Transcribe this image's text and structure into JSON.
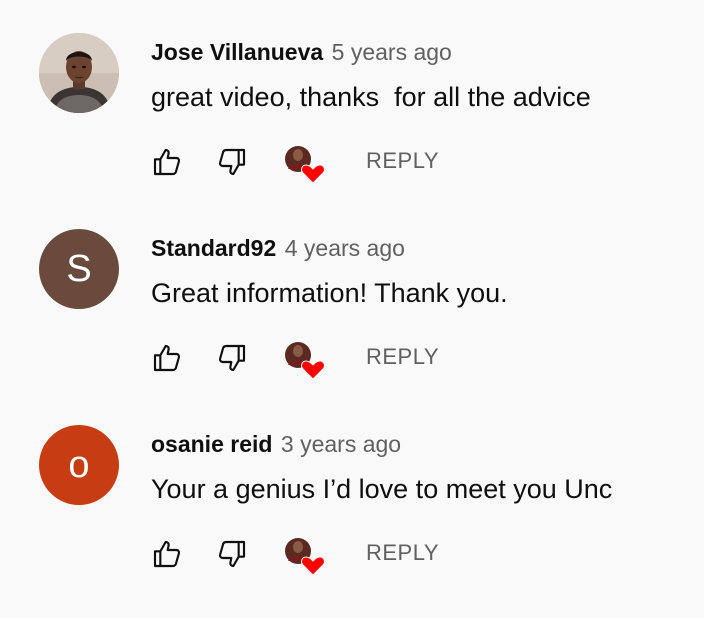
{
  "colors": {
    "background": "#f9f9f9",
    "author_text": "#0f0f0f",
    "meta_text": "#606060",
    "heart": "#ff0000"
  },
  "comments": [
    {
      "author": "Jose Villanueva",
      "time": "5 years ago",
      "text": "great video, thanks  for all the advice",
      "avatar": {
        "type": "photo"
      },
      "like_icon": "thumbs-up-icon",
      "dislike_icon": "thumbs-down-icon",
      "hearted_icon": "creator-heart-icon",
      "reply_label": "REPLY"
    },
    {
      "author": "Standard92",
      "time": "4 years ago",
      "text": "Great information! Thank you.",
      "avatar": {
        "type": "initial",
        "letter": "S",
        "color": "#6a4a3c"
      },
      "like_icon": "thumbs-up-icon",
      "dislike_icon": "thumbs-down-icon",
      "hearted_icon": "creator-heart-icon",
      "reply_label": "REPLY"
    },
    {
      "author": "osanie reid",
      "time": "3 years ago",
      "text": "Your a genius I’d love to meet you Unc",
      "avatar": {
        "type": "initial",
        "letter": "o",
        "color": "#c63d14"
      },
      "like_icon": "thumbs-up-icon",
      "dislike_icon": "thumbs-down-icon",
      "hearted_icon": "creator-heart-icon",
      "reply_label": "REPLY"
    }
  ]
}
